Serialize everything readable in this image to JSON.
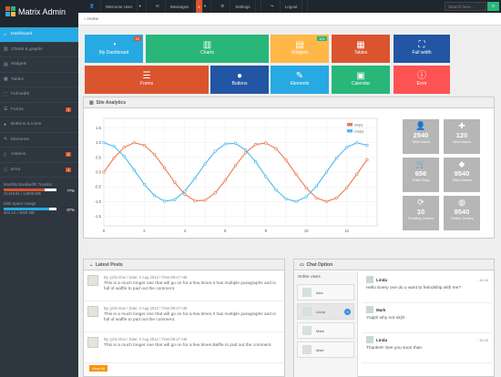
{
  "brand": {
    "name": "Matrix Admin"
  },
  "topnav": {
    "user": "Welcome User",
    "messages": "Messages",
    "messages_count": "5",
    "settings": "Settings",
    "logout": "Logout"
  },
  "search": {
    "placeholder": "Search here..."
  },
  "breadcrumb": {
    "home": "Home"
  },
  "sidebar": {
    "items": [
      {
        "label": "Dashboard",
        "icon": "home-icon"
      },
      {
        "label": "Charts & graphs",
        "icon": "signal-icon"
      },
      {
        "label": "Widgets",
        "icon": "inbox-icon"
      },
      {
        "label": "Tables",
        "icon": "th-icon"
      },
      {
        "label": "Full width",
        "icon": "fullscreen-icon"
      },
      {
        "label": "Forms",
        "icon": "list-icon",
        "count": "3"
      },
      {
        "label": "Buttons & icons",
        "icon": "tint-icon"
      },
      {
        "label": "Elements",
        "icon": "pencil-icon"
      },
      {
        "label": "Addons",
        "icon": "file-icon",
        "count": "5"
      },
      {
        "label": "Error",
        "icon": "info-icon",
        "count": "4"
      }
    ],
    "stats": [
      {
        "label": "Monthly Bandwidth Transfer",
        "detail": "21419.8s / 14000 MB",
        "percent": "77%",
        "fill": 0.77,
        "color": "#da542e"
      },
      {
        "label": "Disk Space Usage",
        "detail": "604.44 / 4000 MB",
        "percent": "87%",
        "fill": 0.87,
        "color": "#27a9e3"
      }
    ]
  },
  "tiles": [
    {
      "label": "My Dashboard",
      "icon": "dashboard-icon",
      "color": "#27a9e3",
      "badge": "20",
      "badge_color": "#da542e"
    },
    {
      "label": "Charts",
      "icon": "signal-icon",
      "color": "#28b779"
    },
    {
      "label": "Widgets",
      "icon": "inbox-icon",
      "color": "#ffb848",
      "badge": "101",
      "badge_color": "#28b779"
    },
    {
      "label": "Tables",
      "icon": "th-icon",
      "color": "#da542e"
    },
    {
      "label": "Full width",
      "icon": "fullscreen-icon",
      "color": "#2255a4"
    },
    {
      "label": "Forms",
      "icon": "list-icon",
      "color": "#da542e"
    },
    {
      "label": "Buttons",
      "icon": "tint-icon",
      "color": "#2255a4"
    },
    {
      "label": "Elements",
      "icon": "pencil-icon",
      "color": "#27a9e3"
    },
    {
      "label": "Calendar",
      "icon": "calendar-icon",
      "color": "#28b779"
    },
    {
      "label": "Error",
      "icon": "info-icon",
      "color": "#ff5252"
    }
  ],
  "analytics": {
    "title": "Site Analytics"
  },
  "chart_data": {
    "type": "line",
    "xlim": [
      0,
      13.5
    ],
    "ylim": [
      -1.25,
      1.25
    ],
    "xticks": [
      "0",
      "2",
      "4",
      "6",
      "8",
      "10",
      "12"
    ],
    "yticks": [
      "1.5",
      "1.0",
      "0.5",
      "0.0",
      "-0.5",
      "-1.0",
      "-1.5"
    ],
    "series": [
      {
        "name": "sin(x)",
        "color": "#ee7951",
        "x": [
          0,
          0.5,
          1,
          1.5,
          2,
          2.5,
          3,
          3.5,
          4,
          4.5,
          5,
          5.5,
          6,
          6.5,
          7,
          7.5,
          8,
          8.5,
          9,
          9.5,
          10,
          10.5,
          11,
          11.5,
          12,
          12.5,
          13
        ],
        "y": [
          0,
          0.48,
          0.84,
          1.0,
          0.91,
          0.6,
          0.14,
          -0.35,
          -0.76,
          -0.98,
          -0.96,
          -0.71,
          -0.28,
          0.22,
          0.66,
          0.94,
          0.99,
          0.8,
          0.41,
          -0.08,
          -0.54,
          -0.88,
          -1.0,
          -0.88,
          -0.54,
          -0.07,
          0.42
        ]
      },
      {
        "name": "cos(x)",
        "color": "#4fb9f0",
        "x": [
          0,
          0.5,
          1,
          1.5,
          2,
          2.5,
          3,
          3.5,
          4,
          4.5,
          5,
          5.5,
          6,
          6.5,
          7,
          7.5,
          8,
          8.5,
          9,
          9.5,
          10,
          10.5,
          11,
          11.5,
          12,
          12.5,
          13
        ],
        "y": [
          1.0,
          0.88,
          0.54,
          0.07,
          -0.42,
          -0.8,
          -0.99,
          -0.94,
          -0.65,
          -0.21,
          0.28,
          0.71,
          0.96,
          0.98,
          0.75,
          0.35,
          -0.15,
          -0.6,
          -0.91,
          -1.0,
          -0.84,
          -0.48,
          0.0,
          0.48,
          0.84,
          1.0,
          0.91
        ]
      }
    ]
  },
  "stat_boxes": [
    {
      "icon": "user-icon",
      "value": "2540",
      "label": "Total Users"
    },
    {
      "icon": "plus-icon",
      "value": "120",
      "label": "New Users"
    },
    {
      "icon": "cart-icon",
      "value": "656",
      "label": "Total Shop"
    },
    {
      "icon": "tag-icon",
      "value": "9540",
      "label": "Total Orders"
    },
    {
      "icon": "repeat-icon",
      "value": "10",
      "label": "Pending Orders"
    },
    {
      "icon": "globe-icon",
      "value": "8540",
      "label": "Online Orders"
    }
  ],
  "latest_posts": {
    "title": "Latest Posts",
    "button": "View All",
    "posts": [
      {
        "meta": "By: john Doe / Date: 2 Aug 2012 / Time:09:27 AM",
        "text": "This is a much longer one that will go on for a few times.It has multiple paragraphs and is full of waffle to pad out the comment."
      },
      {
        "meta": "By: john Doe / Date: 2 Aug 2012 / Time:09:27 AM",
        "text": "This is a much longer one that will go on for a few times.It has multiple paragraphs and is full of waffle to pad out the comment."
      },
      {
        "meta": "By: john Deo / Date: 2 Aug 2012 / Time:09:27 AM",
        "text": "This is a much longer one that will go on for a few times.Baffle to pad out the comment."
      }
    ]
  },
  "chat": {
    "title": "Chat Option",
    "online_title": "Online Users",
    "users": [
      {
        "name": "Alex"
      },
      {
        "name": "Linda",
        "badge": "3"
      },
      {
        "name": "Mark"
      },
      {
        "name": "Maxi"
      }
    ],
    "messages": [
      {
        "name": "Linda",
        "time": "- 10:15",
        "text": "Hello Every one do u want to freindship with me?"
      },
      {
        "name": "Mark",
        "time": "",
        "text": "Yuppi! why not sirji!!."
      },
      {
        "name": "Linda",
        "time": "- 10:15",
        "text": "Thanks!!! See you soon than"
      }
    ]
  }
}
